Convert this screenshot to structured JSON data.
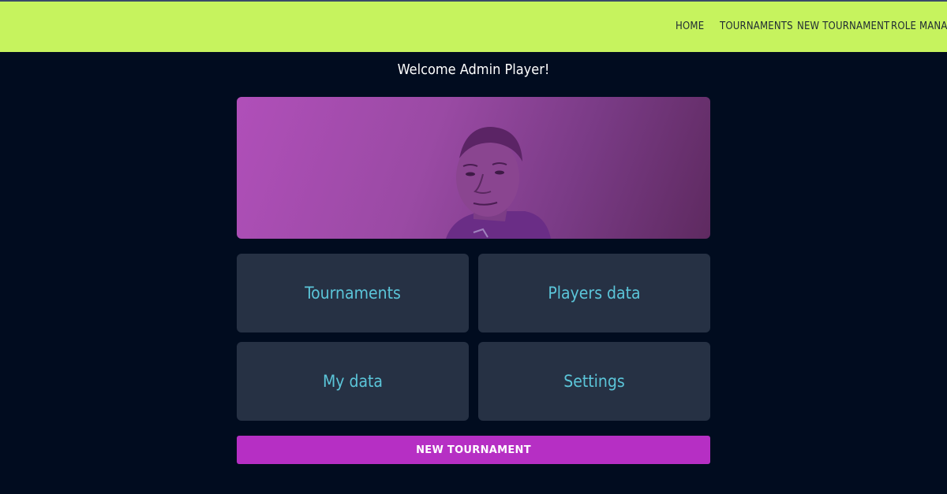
{
  "nav": {
    "items": [
      {
        "label": "HOME"
      },
      {
        "label": "TOURNAMENTS"
      },
      {
        "label": "NEW TOURNAMENT"
      },
      {
        "label": "ROLE MANAG"
      }
    ]
  },
  "welcome_text": "Welcome Admin Player!",
  "tiles": [
    {
      "label": "Tournaments"
    },
    {
      "label": "Players data"
    },
    {
      "label": "My data"
    },
    {
      "label": "Settings"
    }
  ],
  "cta_label": "NEW TOURNAMENT",
  "colors": {
    "navbar_bg": "#c6f35e",
    "page_bg": "#010c1f",
    "tile_bg": "#263144",
    "tile_text": "#5bc5d9",
    "cta_bg": "#b62fc4"
  }
}
